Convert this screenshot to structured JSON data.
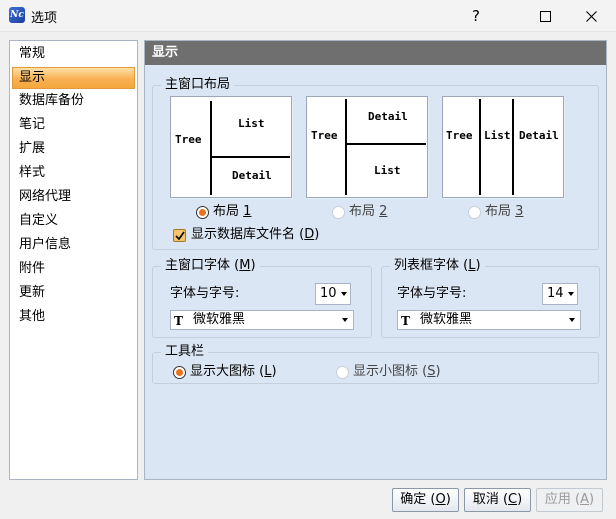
{
  "window": {
    "title": "选项",
    "icon_text": "Nc",
    "help_label": "?"
  },
  "nav": {
    "items": [
      "常规",
      "显示",
      "数据库备份",
      "笔记",
      "扩展",
      "样式",
      "网络代理",
      "自定义",
      "用户信息",
      "附件",
      "更新",
      "其他"
    ],
    "selected": "显示"
  },
  "panel": {
    "header": "显示",
    "main_layout": {
      "label": "主窗口布局",
      "thumbs": [
        {
          "tree": "Tree",
          "list": "List",
          "detail": "Detail"
        },
        {
          "tree": "Tree",
          "list": "List",
          "detail": "Detail"
        },
        {
          "tree": "Tree",
          "list": "List",
          "detail": "Detail"
        }
      ],
      "options": [
        {
          "label": "布局 ",
          "key": "1",
          "selected": true
        },
        {
          "label": "布局 ",
          "key": "2",
          "selected": false
        },
        {
          "label": "布局 ",
          "key": "3",
          "selected": false
        }
      ],
      "show_db_filename": {
        "label": "显示数据库文件名 (",
        "key": "D",
        "suffix": ")",
        "checked": true
      }
    },
    "main_font": {
      "label": "主窗口字体 (",
      "key": "M",
      "suffix": ")",
      "size_label": "字体与字号:",
      "size_value": "10",
      "font_value": "微软雅黑"
    },
    "list_font": {
      "label": "列表框字体 (",
      "key": "L",
      "suffix": ")",
      "size_label": "字体与字号:",
      "size_value": "14",
      "font_value": "微软雅黑"
    },
    "toolbar": {
      "label": "工具栏",
      "large": {
        "label": "显示大图标 (",
        "key": "L",
        "suffix": ")",
        "selected": true
      },
      "small": {
        "label": "显示小图标 (",
        "key": "S",
        "suffix": ")",
        "selected": false
      }
    }
  },
  "buttons": {
    "ok": {
      "label": "确定 (",
      "key": "O",
      "suffix": ")"
    },
    "cancel": {
      "label": "取消 (",
      "key": "C",
      "suffix": ")"
    },
    "apply": {
      "label": "应用 (",
      "key": "A",
      "suffix": ")"
    }
  },
  "colors": {
    "selection_orange": "#f8b152",
    "panel_bg": "#dbe6f4",
    "header_gray": "#6f6f6f",
    "radio_dot": "#e8721c"
  }
}
